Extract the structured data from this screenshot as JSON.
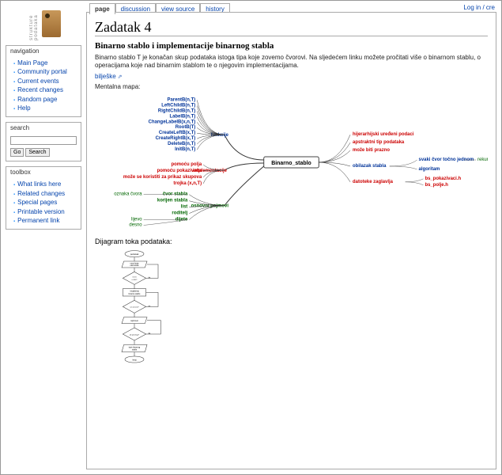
{
  "login": {
    "prefix": "",
    "link": "Log in / cre"
  },
  "logo": {
    "text": "strukture podataka"
  },
  "nav": {
    "heading": "navigation",
    "items": [
      "Main Page",
      "Community portal",
      "Current events",
      "Recent changes",
      "Random page",
      "Help"
    ]
  },
  "search": {
    "heading": "search",
    "go": "Go",
    "search_btn": "Search",
    "value": ""
  },
  "toolbox": {
    "heading": "toolbox",
    "items": [
      "What links here",
      "Related changes",
      "Special pages",
      "Printable version",
      "Permanent link"
    ]
  },
  "tabs": [
    "page",
    "discussion",
    "view source",
    "history"
  ],
  "active_tab": 0,
  "article": {
    "title": "Zadatak 4",
    "heading": "Binarno stablo i implementacije binarnog stabla",
    "intro": "Binarno stablo T je konačan skup podataka istoga tipa koje zovemo čvorovi. Na sljedećem linku možete pročitati više o binarnom stablu, o operacijama koje nad binarnim stablom te o njegovim implementacijama.",
    "link": "bilješke",
    "mentalna": "Mentalna mapa:",
    "dijagram": "Dijagram toka podataka:"
  },
  "mindmap": {
    "center": "Binarno_stablo",
    "funkcije_label": "funkcije",
    "funkcije": [
      "ParentB(n,T)",
      "LeftChildB(n,T)",
      "RightChildB(n,T)",
      "LabelB(n,T)",
      "ChangeLabelB(x,n,T)",
      "RootB(T)",
      "CreateLeftB(x,T)",
      "CreateRightB(x,T)",
      "DeleteB(n,T)",
      "InitB(n,T)"
    ],
    "impl_label": "implementacije",
    "impl": [
      "pomoću polja",
      "pomoću pokazivača",
      "može se koristiti za prikaz skupova",
      "trojka (x,n,T)"
    ],
    "pojmovi_label": "osnovni pojmovi",
    "pojmovi": [
      "čvor stabla",
      "korijen stabla",
      "list",
      "roditelj",
      "dijete"
    ],
    "pojmovi_sub": [
      "oznaka čvora",
      "lijevo",
      "desno"
    ],
    "right": [
      "hijerarhijski uređeni podaci",
      "apstraktni tip podataka",
      "može biti prazno",
      "obilazak stabla",
      "datoteke zaglavlja"
    ],
    "obilazak": [
      "svaki čvor točno jednom",
      "algoritam"
    ],
    "obilazak_sub": "rekurzivno-pozivanje",
    "datoteke": [
      "bs_pokazivaci.h",
      "bs_polje.h"
    ]
  },
  "flowchart": {
    "start": "početak",
    "s1": "unos broja\nelemenata stabla",
    "d1": "n < 0 ili\nn > 100 ?",
    "s2": "inicijaliziraj\nbinarno stablo",
    "d2": "svi uneseni?",
    "s3": "ispiši test",
    "d3": "još pokušaja?",
    "s4": "ispis binarnog\nstabla",
    "end": "kraj",
    "yes": "da",
    "no": "ne"
  }
}
